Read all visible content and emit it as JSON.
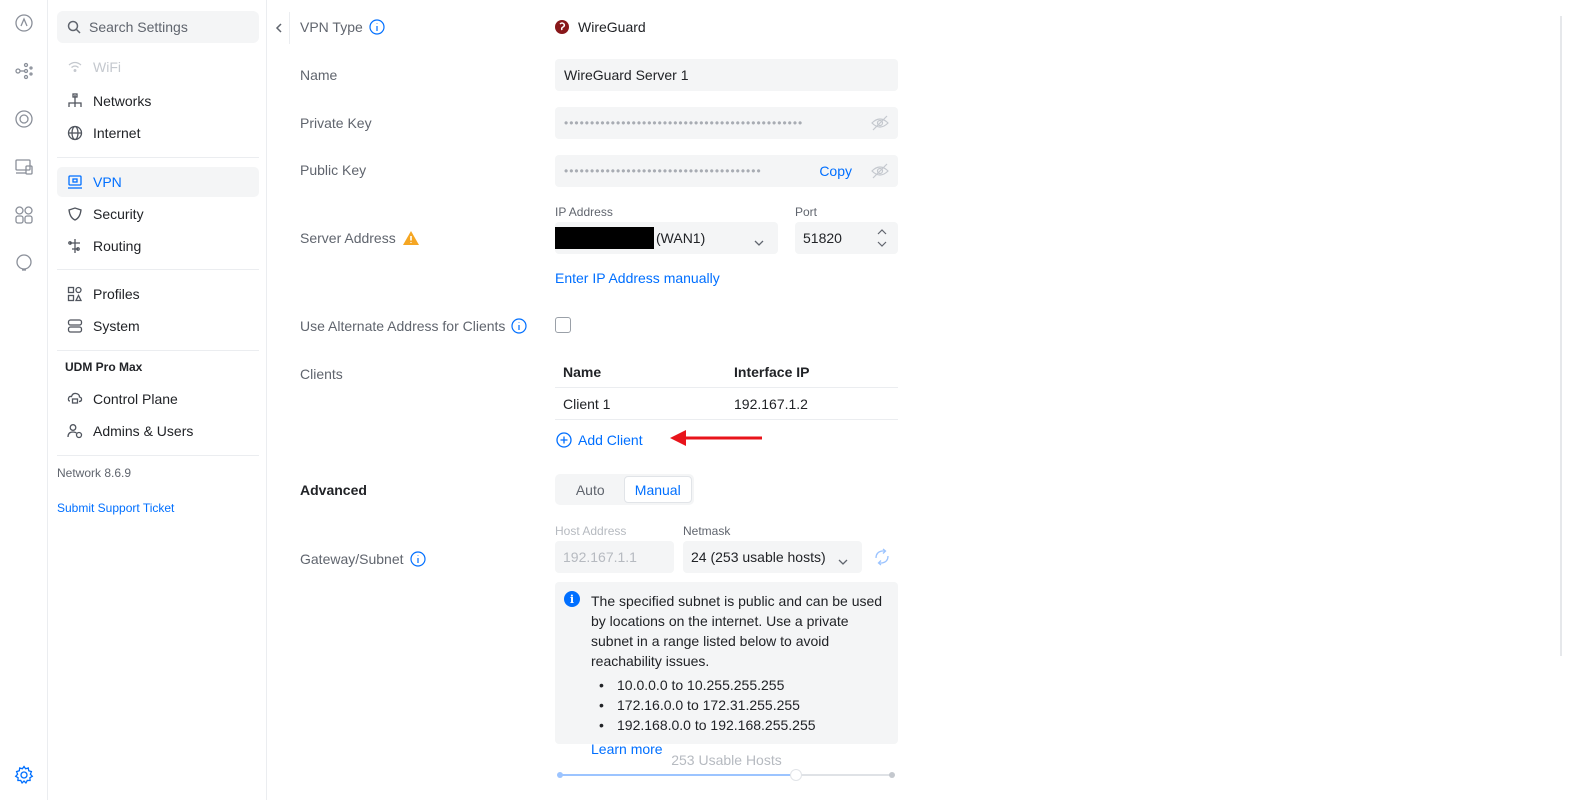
{
  "sidebar": {
    "search_placeholder": "Search Settings",
    "items": {
      "wifi": "WiFi",
      "networks": "Networks",
      "internet": "Internet",
      "vpn": "VPN",
      "security": "Security",
      "routing": "Routing",
      "profiles": "Profiles",
      "system": "System",
      "control_plane": "Control Plane",
      "admins_users": "Admins & Users"
    },
    "section_title": "UDM Pro Max",
    "version": "Network 8.6.9",
    "support_link": "Submit Support Ticket"
  },
  "form": {
    "vpn_type_label": "VPN Type",
    "vpn_type_value": "WireGuard",
    "name_label": "Name",
    "name_value": "WireGuard Server 1",
    "private_key_label": "Private Key",
    "private_key_value": "••••••••••••••••••••••••••••••••••••••••••••••",
    "public_key_label": "Public Key",
    "public_key_value": "••••••••••••••••••••••••••••••••••••••",
    "copy_label": "Copy",
    "server_address_label": "Server Address",
    "ip_address_label": "IP Address",
    "ip_address_value": "(WAN1)",
    "port_label": "Port",
    "port_value": "51820",
    "enter_ip_manually": "Enter IP Address manually",
    "alt_address_label": "Use Alternate Address for Clients",
    "clients_label": "Clients",
    "clients_table": {
      "headers": [
        "Name",
        "Interface IP"
      ],
      "rows": [
        [
          "Client 1",
          "192.167.1.2"
        ]
      ]
    },
    "add_client": "Add Client",
    "advanced_label": "Advanced",
    "advanced_options": [
      "Auto",
      "Manual"
    ],
    "advanced_selected": "Manual",
    "gateway_label": "Gateway/Subnet",
    "host_address_label": "Host Address",
    "host_address_value": "192.167.1.1",
    "netmask_label": "Netmask",
    "netmask_value": "24 (253 usable hosts)",
    "notice_text": "The specified subnet is public and can be used by locations on the internet. Use a private subnet in a range listed below to avoid reachability issues.",
    "ranges": [
      "10.0.0.0 to 10.255.255.255",
      "172.16.0.0 to 172.31.255.255",
      "192.168.0.0 to 192.168.255.255"
    ],
    "learn_more": "Learn more",
    "usable_hosts": "253 Usable Hosts",
    "slider_fraction": 0.71
  },
  "colors": {
    "accent": "#006fff",
    "warning": "#f5a623",
    "annotation_arrow": "#e8141b",
    "wireguard_brand": "#88171a"
  }
}
